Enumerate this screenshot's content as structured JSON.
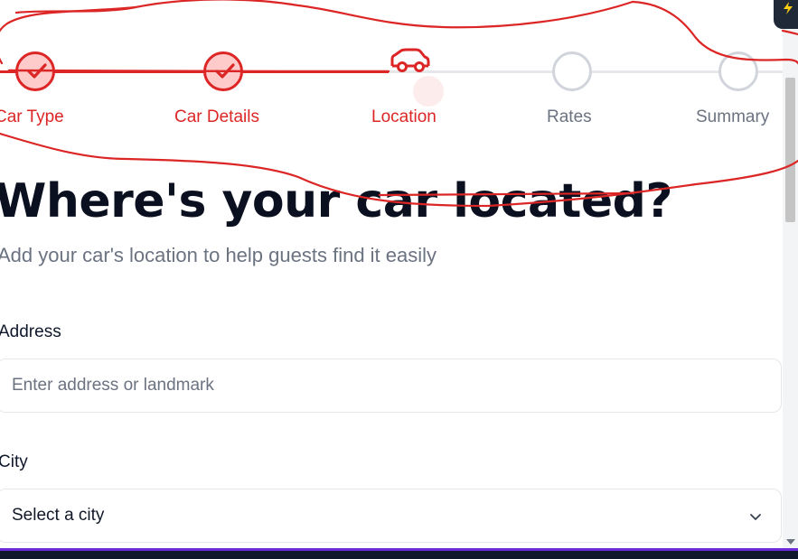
{
  "stepper": {
    "steps": [
      {
        "label": "Car Type",
        "status": "done"
      },
      {
        "label": "Car Details",
        "status": "done"
      },
      {
        "label": "Location",
        "status": "current"
      },
      {
        "label": "Rates",
        "status": "pending"
      },
      {
        "label": "Summary",
        "status": "pending"
      }
    ]
  },
  "heading": {
    "title": "Where's your car located?",
    "subtitle": "Add your car's location to help guests find it easily"
  },
  "form": {
    "address": {
      "label": "Address",
      "placeholder": "Enter address or landmark"
    },
    "city": {
      "label": "City",
      "selected": "Select a city"
    }
  },
  "colors": {
    "accent": "#dc2626",
    "done_fill": "#fecaca",
    "pending_border": "#d1d5db",
    "text_muted": "#6b7280",
    "title": "#0b1020",
    "annotation": "#dc2626"
  },
  "icons": {
    "done_step": "check-icon",
    "current_step": "car-icon",
    "city_dropdown": "chevron-down-icon",
    "corner": "bolt-icon"
  }
}
